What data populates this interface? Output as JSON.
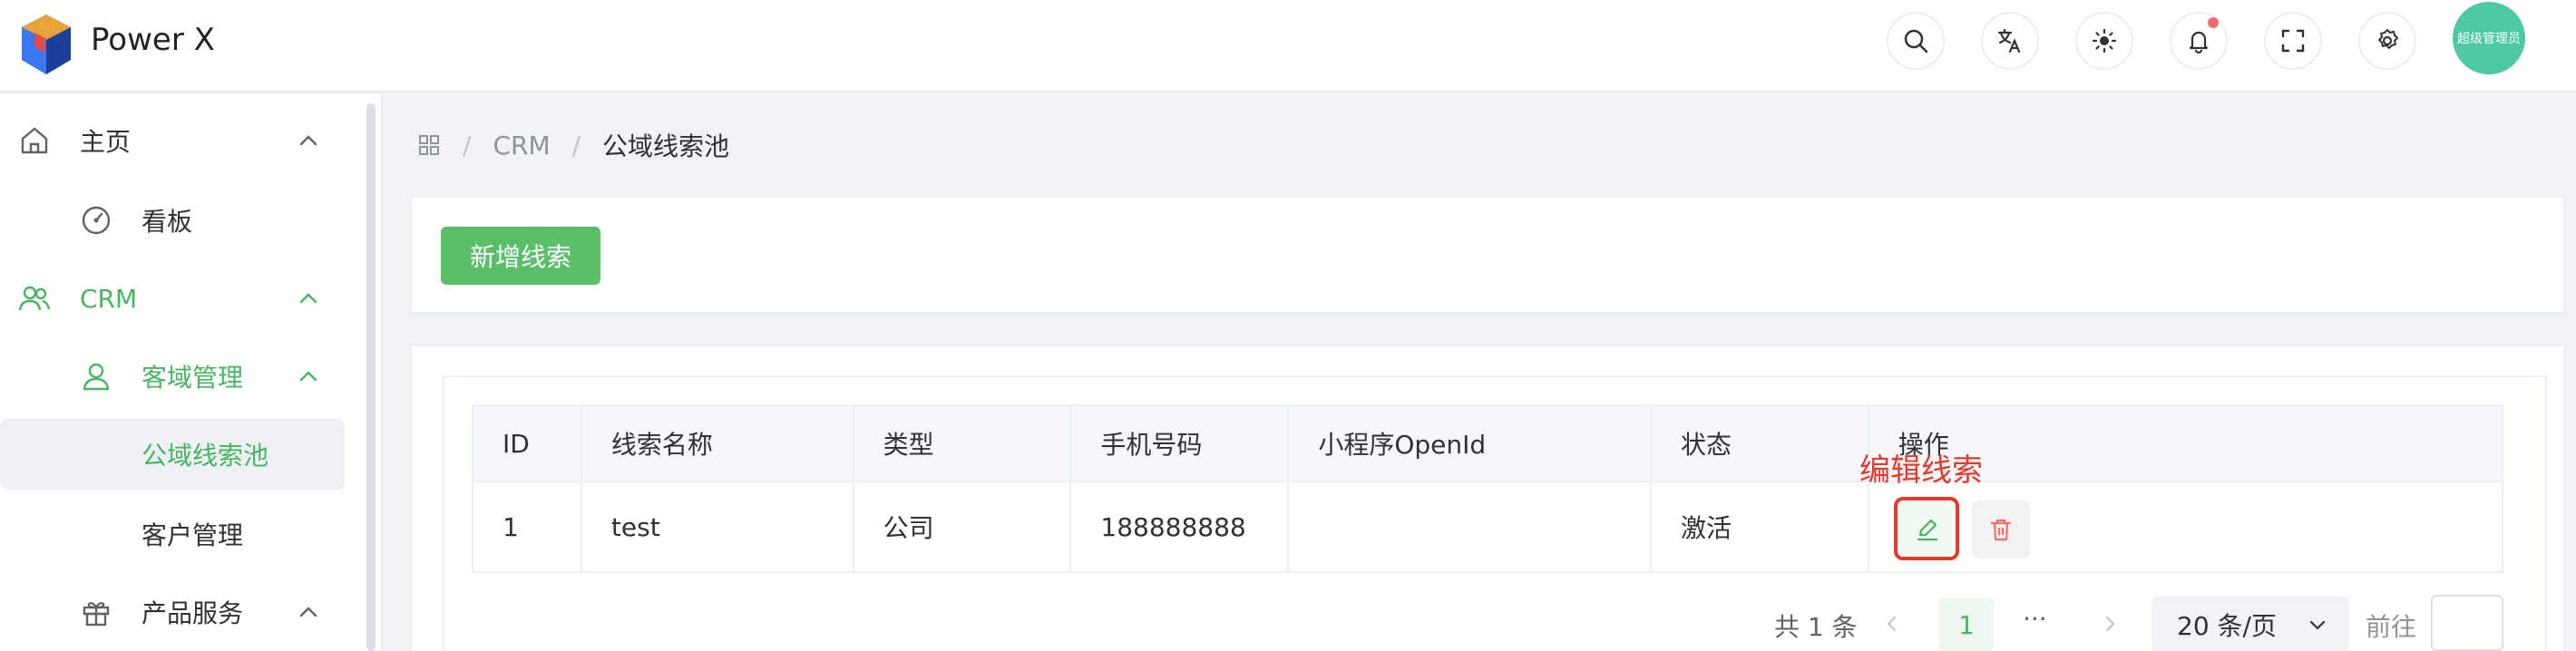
{
  "app": {
    "title": "Power X"
  },
  "header": {
    "avatar_text": "超级管理员",
    "icons": [
      "search-icon",
      "translate-icon",
      "theme-sun-icon",
      "bell-icon",
      "fullscreen-icon",
      "gear-icon"
    ]
  },
  "sidebar": {
    "items": [
      {
        "label": "主页",
        "icon": "home-icon"
      },
      {
        "label": "看板",
        "icon": "dashboard-icon"
      },
      {
        "label": "CRM",
        "icon": "users-icon"
      },
      {
        "label": "客域管理",
        "icon": "user-icon"
      },
      {
        "label": "公域线索池"
      },
      {
        "label": "客户管理"
      },
      {
        "label": "产品服务",
        "icon": "gift-icon"
      }
    ]
  },
  "breadcrumb": {
    "items": [
      "CRM",
      "公域线索池"
    ]
  },
  "toolbar": {
    "add_lead_label": "新增线索"
  },
  "table": {
    "headers": [
      "ID",
      "线索名称",
      "类型",
      "手机号码",
      "小程序OpenId",
      "状态",
      "操作"
    ],
    "rows": [
      {
        "id": "1",
        "name": "test",
        "type": "公司",
        "phone": "188888888",
        "openid": "",
        "status": "激活"
      }
    ]
  },
  "annotation": {
    "text": "编辑线索"
  },
  "pagination": {
    "total_text": "共 1 条",
    "current_page": "1",
    "ellipsis": "···",
    "page_size": "20 条/页",
    "goto_label": "前往"
  },
  "colors": {
    "accent": "#47b561",
    "primary_button": "#5bbf6a",
    "annotation": "#e03b2d",
    "danger": "#f56c6c"
  }
}
